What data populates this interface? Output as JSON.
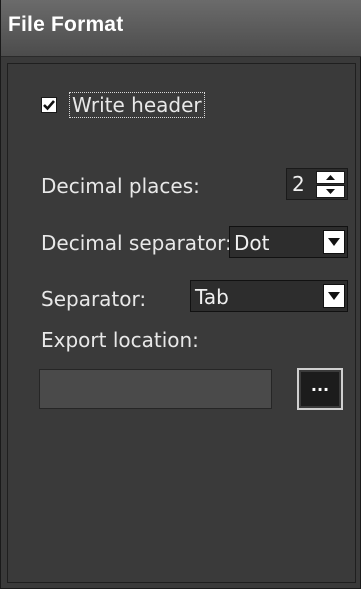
{
  "panel": {
    "title": "File Format"
  },
  "write_header": {
    "label": "Write header",
    "checked": true
  },
  "decimal_places": {
    "label": "Decimal places:",
    "value": "2"
  },
  "decimal_separator": {
    "label": "Decimal separator:",
    "selected": "Dot"
  },
  "separator": {
    "label": "Separator:",
    "selected": "Tab"
  },
  "export_location": {
    "label": "Export location:",
    "value": "",
    "browse_label": "..."
  },
  "icons": {
    "checkbox": "checkmark-icon",
    "spin_up": "triangle-up-icon",
    "spin_down": "triangle-down-icon",
    "dropdown": "chevron-down-icon"
  },
  "colors": {
    "panel_bg": "#3a3a3a",
    "title_bg": "#5a5a5a",
    "text": "#e8e8e8",
    "field_bg": "#2d2d2d"
  }
}
